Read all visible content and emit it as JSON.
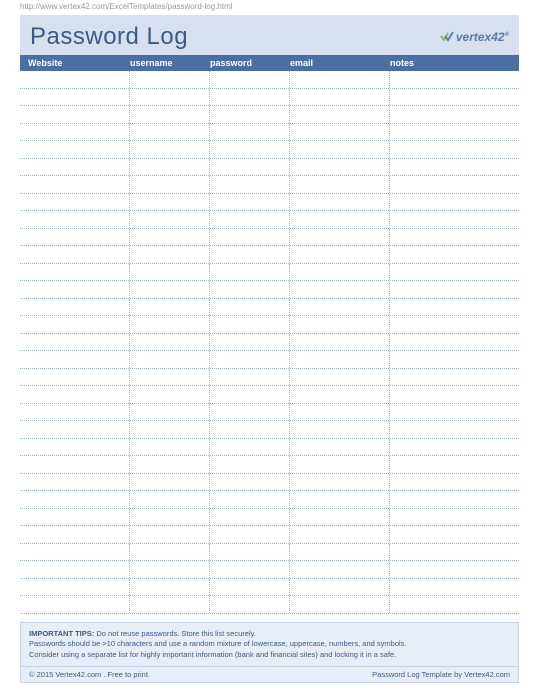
{
  "url": "http://www.vertex42.com/ExcelTemplates/password-log.html",
  "title": "Password Log",
  "logo": {
    "text": "vertex",
    "num": "42"
  },
  "columns": {
    "website": "Website",
    "username": "username",
    "password": "password",
    "email": "email",
    "notes": "notes"
  },
  "row_count": 31,
  "tips": {
    "label": "IMPORTANT TIPS:",
    "line1": "Do not reuse passwords. Store this list securely.",
    "line2": "Passwords should be >10 characters and use a random mixture of lowercase, uppercase, numbers, and symbols.",
    "line3": "Consider using a separate list for highly important information (bank and financial sites) and locking it in a safe."
  },
  "footer": {
    "left": "© 2015 Vertex42.com . Free to print.",
    "right": "Password Log Template by Vertex42.com"
  }
}
